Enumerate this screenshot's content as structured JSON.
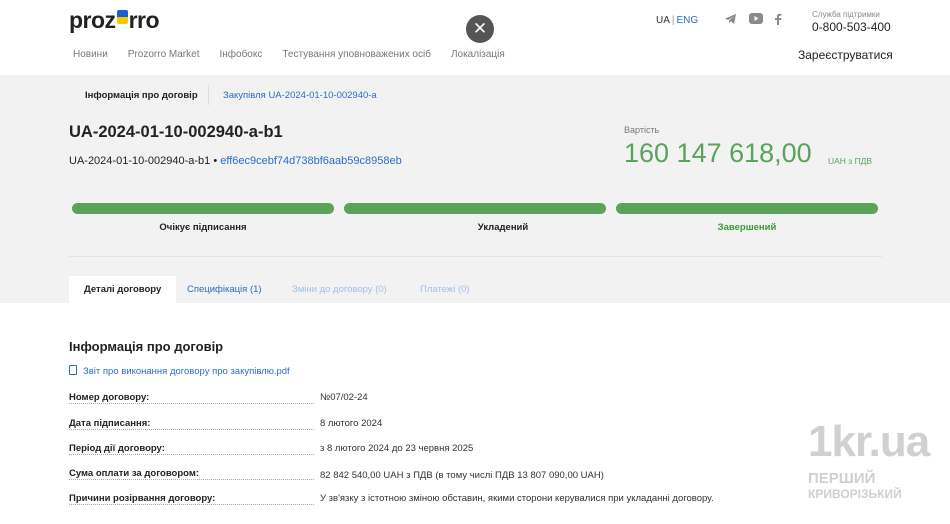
{
  "header": {
    "logo": "prozorro",
    "lang_ua": "UA",
    "lang_eng": "ENG",
    "support_label": "Служба підтримки",
    "support_phone": "0-800-503-400",
    "nav": [
      "Новини",
      "Prozorro Market",
      "Інфобокс",
      "Тестування уповноважених осіб",
      "Локалізація"
    ],
    "register": "Зареєструватися"
  },
  "breadcrumb": {
    "current": "Інформація про договір",
    "link": "Закупівля UA-2024-01-10-002940-a"
  },
  "contract": {
    "id": "UA-2024-01-10-002940-a-b1",
    "sub_id": "UA-2024-01-10-002940-a-b1",
    "hash": "eff6ec9cebf74d738bf6aab59c8958eb",
    "value_label": "Вартість",
    "value": "160 147 618,00",
    "currency": "UAH з ПДВ"
  },
  "stages": [
    {
      "label": "Очікує підписання",
      "progress": 1.0
    },
    {
      "label": "Укладений",
      "progress": 1.0
    },
    {
      "label": "Завершений",
      "progress": 1.0
    }
  ],
  "tabs": [
    "Деталі договору",
    "Специфікація (1)",
    "Зміни до договору (0)",
    "Платежі (0)"
  ],
  "details": {
    "title": "Інформація про договір",
    "document": "Звіт про виконання договору про закупівлю.pdf",
    "rows": [
      {
        "label": "Номер договору:",
        "value": "№07/02-24"
      },
      {
        "label": "Дата підписання:",
        "value": "8 лютого 2024"
      },
      {
        "label": "Період дії договору:",
        "value": "з 8 лютого 2024 до 23 червня 2025"
      },
      {
        "label": "Сума оплати за договором:",
        "value": "82 842 540,00 UAH з ПДВ (в тому числі ПДВ 13 807 090,00 UAH)"
      },
      {
        "label": "Причини розірвання договору:",
        "value": "У зв'язку з істотною зміною обставин, якими сторони керувалися при укладанні договору."
      }
    ]
  },
  "watermark": {
    "big": "1kr.ua",
    "line1": "ПЕРШИЙ",
    "line2": "КРИВОРІЗЬКИЙ"
  },
  "colors": {
    "accent": "#2a6dc7",
    "success": "#5aa45a",
    "bg_grey": "#f2f2f2"
  },
  "icons": [
    "close-icon",
    "telegram-icon",
    "youtube-icon",
    "facebook-icon",
    "document-icon"
  ]
}
